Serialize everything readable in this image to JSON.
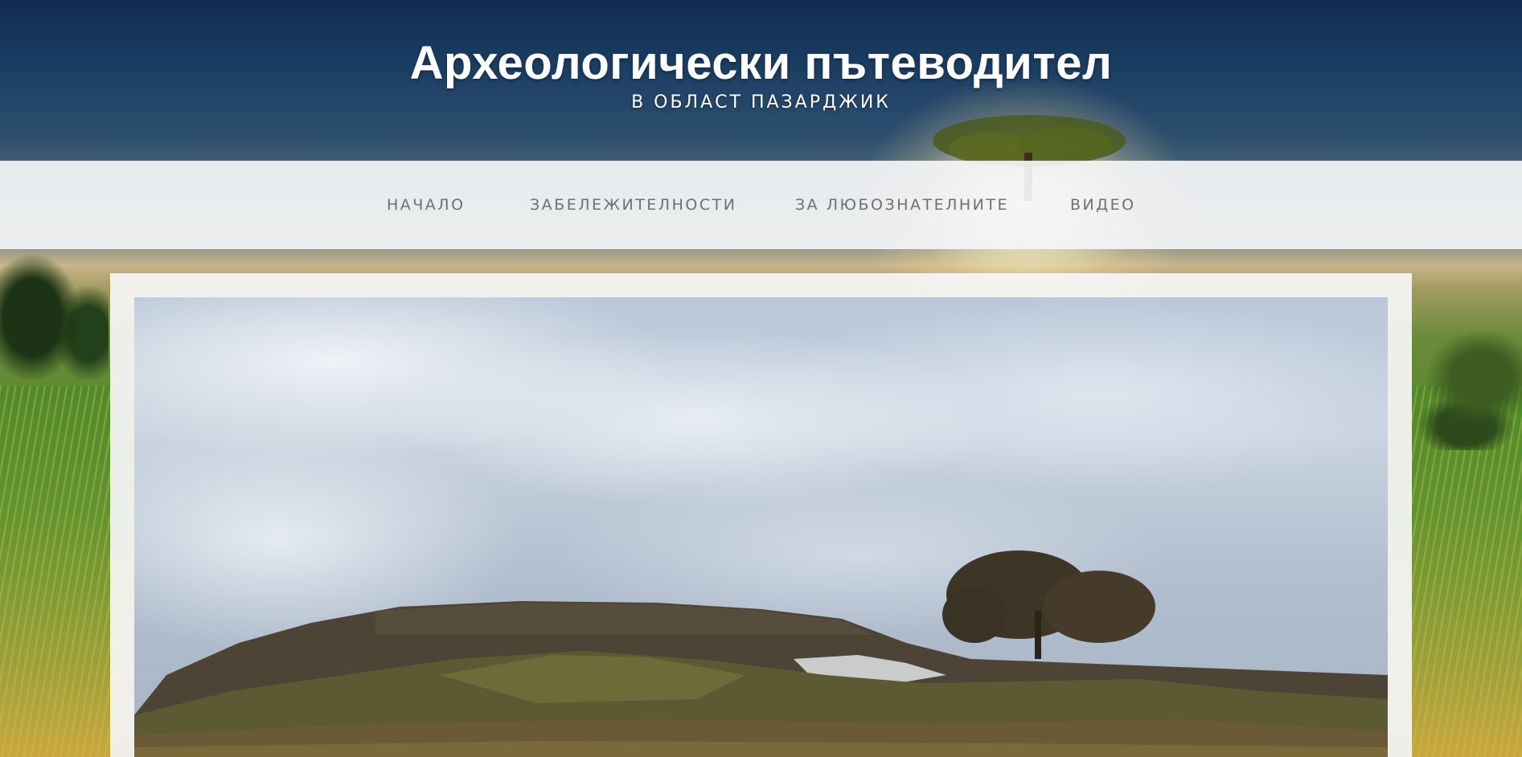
{
  "header": {
    "title": "Археологически пътеводител",
    "subtitle": "В ОБЛАСТ ПАЗАРДЖИК"
  },
  "nav": {
    "items": [
      {
        "label": "НАЧАЛО"
      },
      {
        "label": "ЗАБЕЛЕЖИТЕЛНОСТИ"
      },
      {
        "label": "ЗА ЛЮБОЗНАТЕЛНИТЕ"
      },
      {
        "label": "ВИДЕО"
      }
    ]
  },
  "colors": {
    "nav_text": "#6d6f72",
    "nav_background": "#f4f5f6",
    "header_text": "#ffffff",
    "sky_top": "#0f2c4e"
  },
  "slider": {
    "image": "archaeological-mound-photo"
  }
}
